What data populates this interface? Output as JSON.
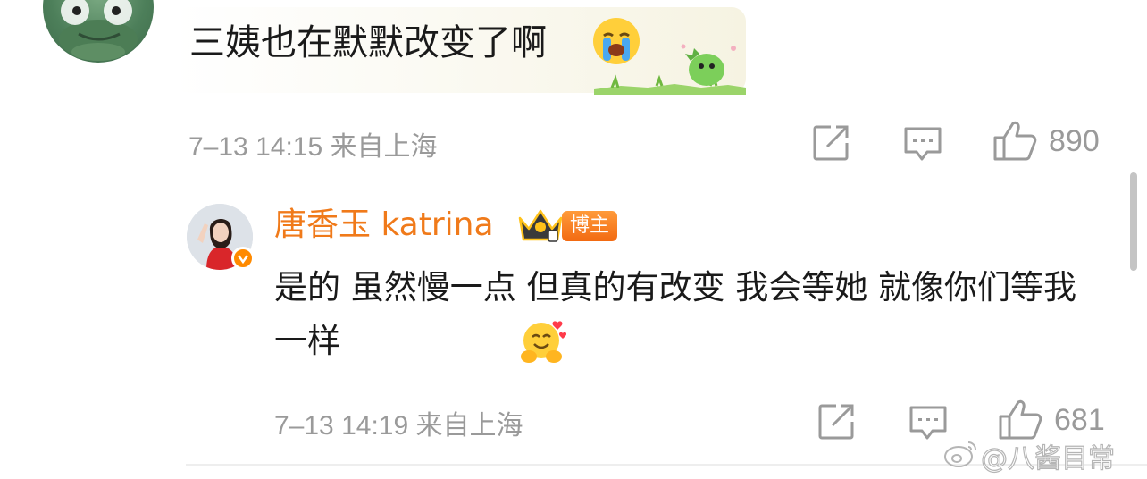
{
  "comment": {
    "text": "三姨也在默默改变了啊",
    "emoji_icon": "loudly-crying-face-icon",
    "sticker_icon": "dinosaur-sticker-icon",
    "date": "7–13",
    "time": "14:15",
    "location": "来自上海",
    "like_count": "890"
  },
  "reply": {
    "author": "唐香玉 katrina",
    "crown_icon": "crown-level-icon",
    "badge": "博主",
    "text": "是的 虽然慢一点 但真的有改变 我会等她 就像你们等我一样",
    "emoji_icon": "hugging-face-hearts-icon",
    "date": "7–13",
    "time": "14:19",
    "location": "来自上海",
    "like_count": "681"
  },
  "watermark": "@八酱目常",
  "colors": {
    "accent_orange": "#f07a1a",
    "meta_gray": "#9a9a9a",
    "badge_orange": "#f26a12"
  }
}
